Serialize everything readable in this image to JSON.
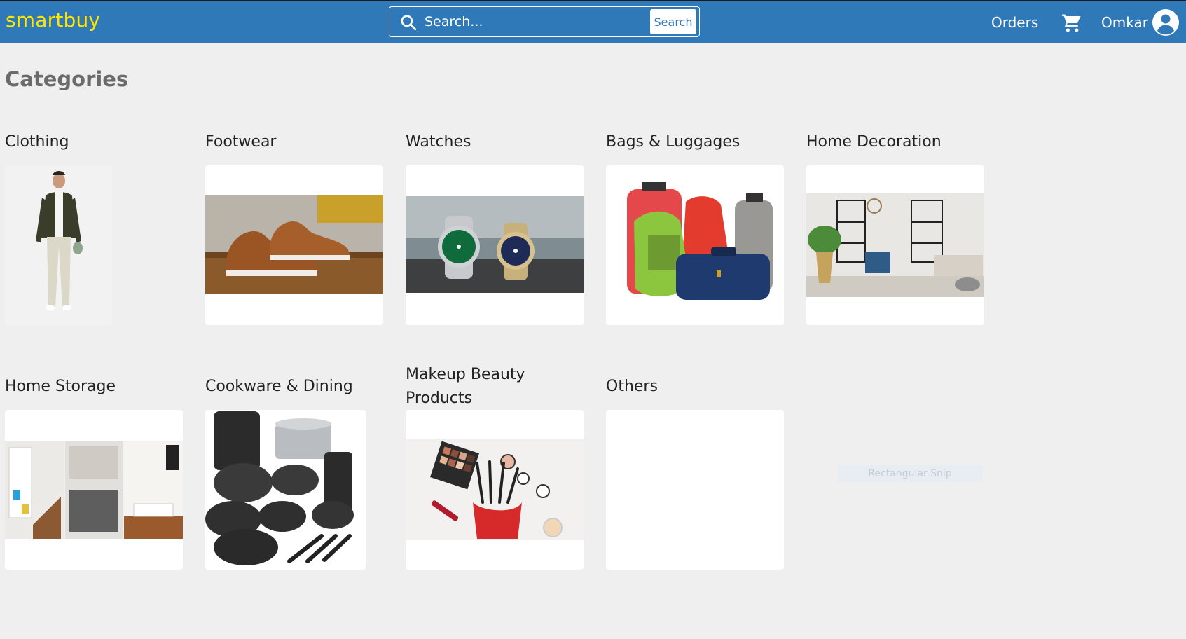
{
  "header": {
    "logo": "smartbuy",
    "search_placeholder": "Search...",
    "search_button": "Search",
    "orders_label": "Orders",
    "cart_icon": "shopping-cart-icon",
    "user_name": "Omkar",
    "avatar_icon": "user-avatar-icon"
  },
  "main": {
    "title": "Categories",
    "categories": [
      {
        "label": "Clothing"
      },
      {
        "label": "Footwear"
      },
      {
        "label": "Watches"
      },
      {
        "label": "Bags & Luggages"
      },
      {
        "label": "Home Decoration"
      },
      {
        "label": "Home Storage"
      },
      {
        "label": "Cookware & Dining"
      },
      {
        "label": "Makeup Beauty Products"
      },
      {
        "label": "Others"
      }
    ]
  },
  "overlay": {
    "snip_label": "Rectangular Snip"
  },
  "colors": {
    "header_bg": "#2f79b9",
    "logo": "#ffe600",
    "page_bg": "#efefef"
  }
}
